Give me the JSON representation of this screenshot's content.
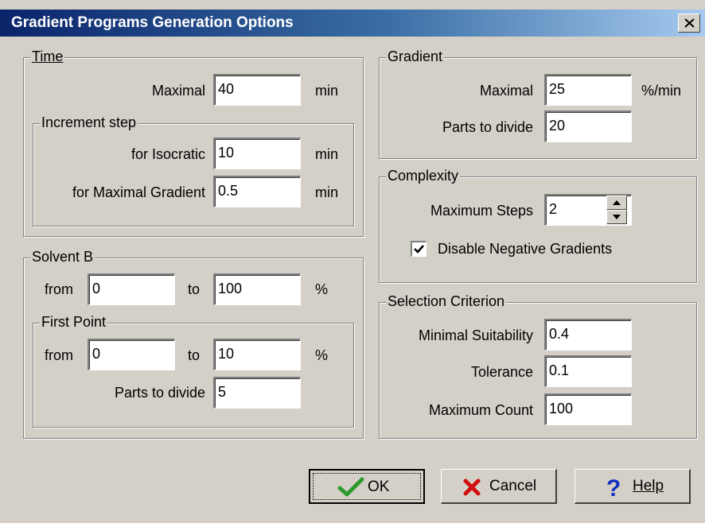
{
  "dialog": {
    "title": "Gradient Programs Generation Options",
    "close_icon": "close-icon"
  },
  "time": {
    "legend": "Time",
    "maximal_label": "Maximal",
    "maximal_value": "40",
    "maximal_unit": "min",
    "increment": {
      "legend": "Increment step",
      "isocratic_label": "for Isocratic",
      "isocratic_value": "10",
      "isocratic_unit": "min",
      "max_gradient_label": "for Maximal Gradient",
      "max_gradient_value": "0.5",
      "max_gradient_unit": "min"
    }
  },
  "solvent": {
    "legend": "Solvent B",
    "from_label": "from",
    "from_value": "0",
    "to_label": "to",
    "to_value": "100",
    "unit": "%",
    "first_point": {
      "legend": "First Point",
      "from_label": "from",
      "from_value": "0",
      "to_label": "to",
      "to_value": "10",
      "unit": "%",
      "parts_label": "Parts to divide",
      "parts_value": "5"
    }
  },
  "gradient": {
    "legend": "Gradient",
    "maximal_label": "Maximal",
    "maximal_value": "25",
    "maximal_unit": "%/min",
    "parts_label": "Parts to divide",
    "parts_value": "20"
  },
  "complexity": {
    "legend": "Complexity",
    "max_steps_label": "Maximum Steps",
    "max_steps_value": "2",
    "disable_negative_label": "Disable Negative Gradients",
    "disable_negative_checked": true
  },
  "selection": {
    "legend": "Selection Criterion",
    "min_suit_label": "Minimal Suitability",
    "min_suit_value": "0.4",
    "tolerance_label": "Tolerance",
    "tolerance_value": "0.1",
    "max_count_label": "Maximum Count",
    "max_count_value": "100"
  },
  "buttons": {
    "ok": "OK",
    "cancel": "Cancel",
    "help": "Help"
  },
  "colors": {
    "dialog_bg": "#d4d0c8",
    "title_start": "#0a246a",
    "title_end": "#a6caf0",
    "ok_check": "#2e9a2e",
    "cancel_x": "#d01010",
    "help_q": "#1030c0"
  }
}
